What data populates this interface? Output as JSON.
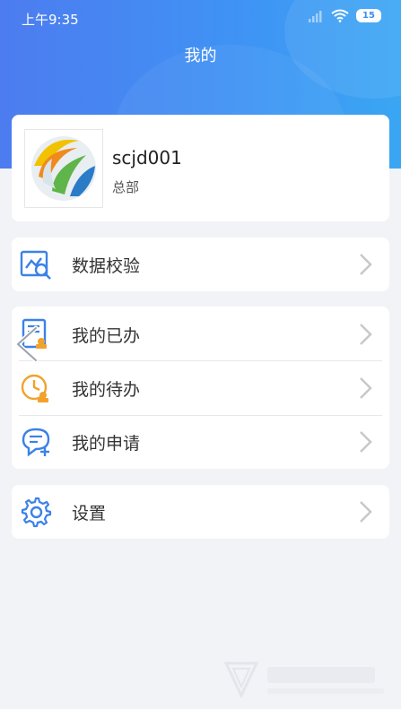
{
  "status_bar": {
    "time": "上午9:35",
    "battery": "15"
  },
  "header": {
    "title": "我的"
  },
  "profile": {
    "username": "scjd001",
    "org": "总部"
  },
  "menu_groups": [
    {
      "items": [
        {
          "label": "数据校验",
          "icon": "chart-search-icon"
        }
      ]
    },
    {
      "items": [
        {
          "label": "我的已办",
          "icon": "done-doc-icon"
        },
        {
          "label": "我的待办",
          "icon": "pending-clock-icon"
        },
        {
          "label": "我的申请",
          "icon": "apply-chat-icon"
        }
      ]
    },
    {
      "items": [
        {
          "label": "设置",
          "icon": "gear-icon"
        }
      ]
    }
  ],
  "colors": {
    "header_start": "#4d7cf0",
    "header_end": "#3aa6f3",
    "icon_blue": "#3b82e8",
    "icon_orange": "#f1a22b"
  }
}
